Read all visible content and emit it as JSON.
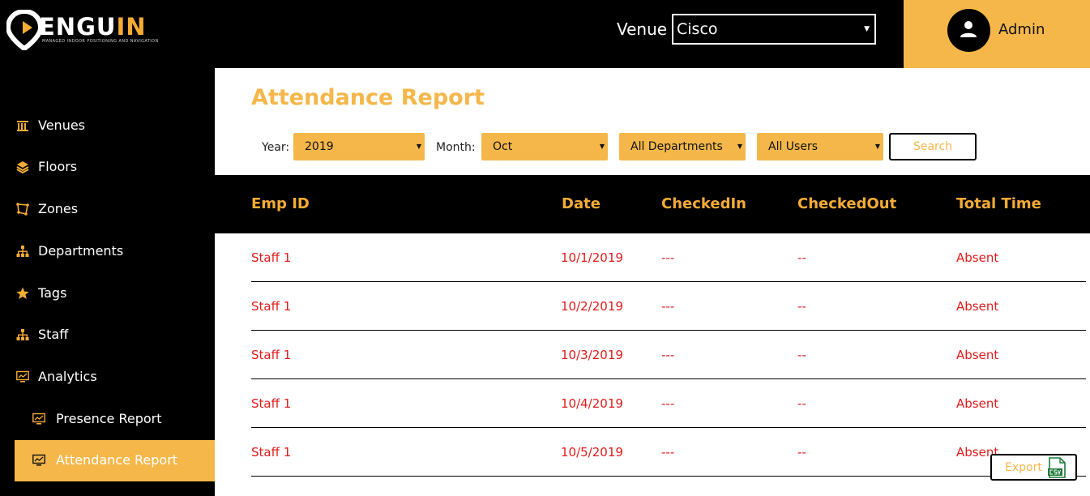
{
  "brand": {
    "logo_prefix": "ENGU",
    "logo_suffix": "IN",
    "tagline": "MANAGED INDOOR POSITIONING AND NAVIGATION"
  },
  "header": {
    "venue_label": "Venue",
    "venue_value": "Cisco",
    "user_name": "Admin"
  },
  "sidebar": {
    "items": [
      {
        "label": "Venues",
        "icon": "building-icon"
      },
      {
        "label": "Floors",
        "icon": "layers-icon"
      },
      {
        "label": "Zones",
        "icon": "polygon-icon"
      },
      {
        "label": "Departments",
        "icon": "org-chart-icon"
      },
      {
        "label": "Tags",
        "icon": "star-icon"
      },
      {
        "label": "Staff",
        "icon": "org-chart-icon"
      },
      {
        "label": "Analytics",
        "icon": "monitor-chart-icon"
      }
    ],
    "sub_items": [
      {
        "label": "Presence Report",
        "icon": "monitor-chart-icon"
      },
      {
        "label": "Attendance Report",
        "icon": "monitor-chart-icon",
        "active": true
      }
    ]
  },
  "main": {
    "title": "Attendance Report",
    "filters": {
      "year_label": "Year:",
      "year_value": "2019",
      "month_label": "Month:",
      "month_value": "Oct",
      "department_value": "All Departments",
      "user_value": "All Users",
      "search_label": "Search"
    },
    "table": {
      "headers": [
        "Emp ID",
        "Date",
        "CheckedIn",
        "CheckedOut",
        "Total Time"
      ],
      "rows": [
        [
          "Staff 1",
          "10/1/2019",
          "---",
          "--",
          "Absent"
        ],
        [
          "Staff 1",
          "10/2/2019",
          "---",
          "--",
          "Absent"
        ],
        [
          "Staff 1",
          "10/3/2019",
          "---",
          "--",
          "Absent"
        ],
        [
          "Staff 1",
          "10/4/2019",
          "---",
          "--",
          "Absent"
        ],
        [
          "Staff 1",
          "10/5/2019",
          "---",
          "--",
          "Absent"
        ]
      ]
    },
    "export_label": "Export"
  },
  "colors": {
    "accent": "#f5b74a",
    "header_text": "#f5ac35",
    "row_text": "#e01b1b",
    "background": "#000000"
  }
}
